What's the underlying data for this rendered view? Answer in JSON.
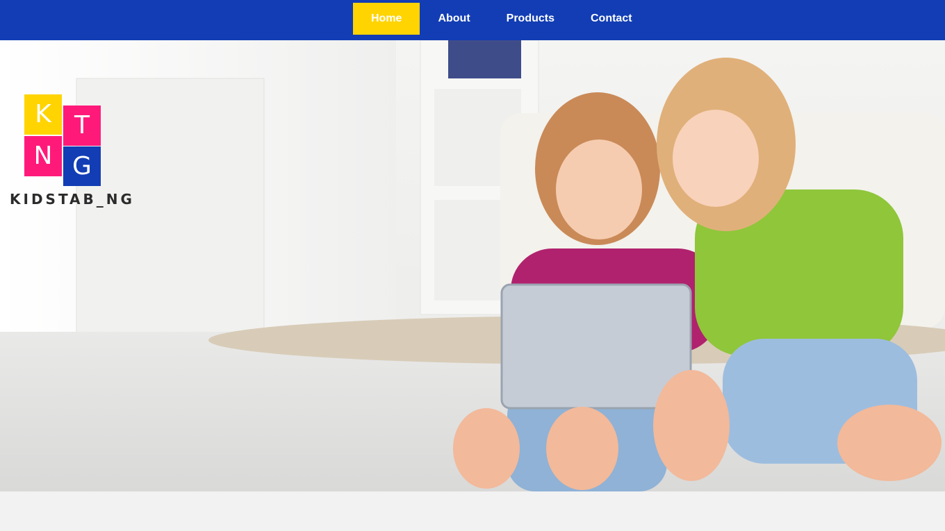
{
  "nav": {
    "items": [
      {
        "label": "Home",
        "active": true
      },
      {
        "label": "About",
        "active": false
      },
      {
        "label": "Products",
        "active": false
      },
      {
        "label": "Contact",
        "active": false
      }
    ]
  },
  "logo": {
    "tiles": [
      "K",
      "T",
      "N",
      "G"
    ],
    "wordmark": "KIDSTAB_NG"
  },
  "colors": {
    "nav_bg": "#123db4",
    "active_bg": "#ffd400",
    "pink": "#ff1a7a",
    "page_bg": "#f2f2f2"
  }
}
